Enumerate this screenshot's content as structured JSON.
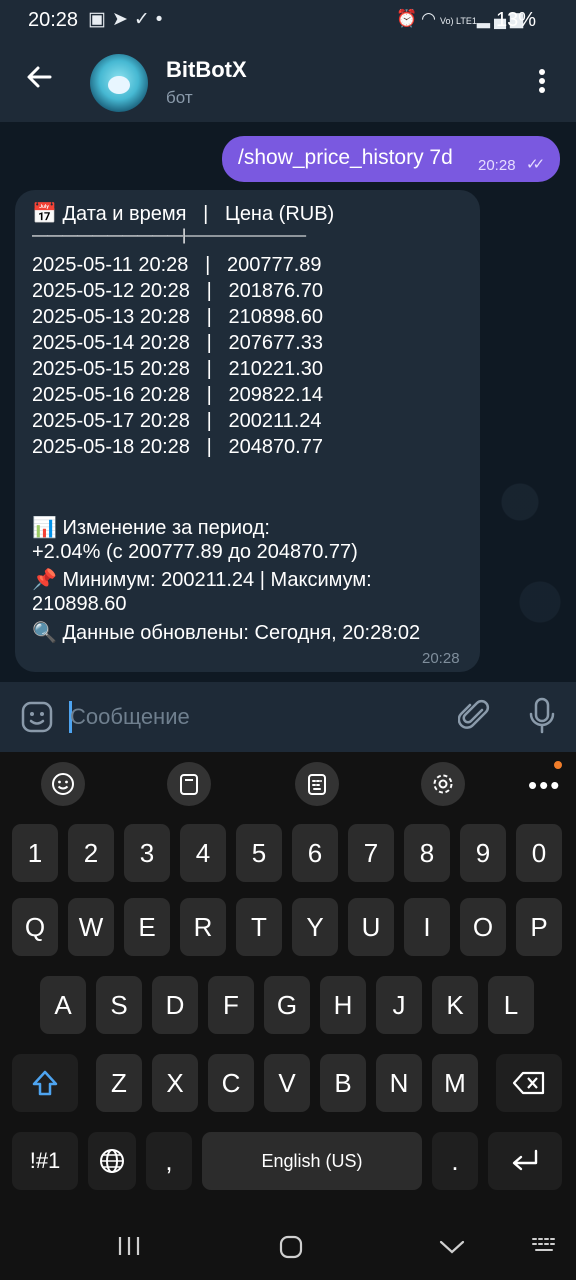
{
  "status_bar": {
    "time": "20:28",
    "left_icons": [
      "gallery-icon",
      "telegram-icon",
      "check-circle-icon",
      "dot-icon"
    ],
    "right_icons": [
      "alarm-icon",
      "wifi-icon",
      "volte-icon",
      "signal-icon"
    ],
    "volte_label": "Vo) LTE1",
    "battery": "13%"
  },
  "header": {
    "title": "BitBotX",
    "subtitle": "бот"
  },
  "messages": {
    "outgoing": {
      "text": "/show_price_history 7d",
      "time": "20:28"
    },
    "incoming": {
      "header_line": "📅 Дата и время   |   Цена (RUB)",
      "separator": "——————————|————————",
      "rows": [
        "2025-05-11 20:28   |   200777.89",
        "2025-05-12 20:28   |   201876.70",
        "2025-05-13 20:28   |   210898.60",
        "2025-05-14 20:28   |   207677.33",
        "2025-05-15 20:28   |   210221.30",
        "2025-05-16 20:28   |   209822.14",
        "2025-05-17 20:28   |   200211.24",
        "2025-05-18 20:28   |   204870.77"
      ],
      "change_title": "📊 Изменение за период:",
      "change_value": "+2.04% (с 200777.89 до 204870.77)",
      "min_max_line1": "📌 Минимум: 200211.24 | Максимум:",
      "min_max_line2": "210898.60",
      "updated": "🔍 Данные обновлены: Сегодня, 20:28:02",
      "time": "20:28"
    }
  },
  "composer": {
    "placeholder": "Сообщение"
  },
  "keyboard": {
    "row_numbers": [
      "1",
      "2",
      "3",
      "4",
      "5",
      "6",
      "7",
      "8",
      "9",
      "0"
    ],
    "row_top": [
      "Q",
      "W",
      "E",
      "R",
      "T",
      "Y",
      "U",
      "I",
      "O",
      "P"
    ],
    "row_mid": [
      "A",
      "S",
      "D",
      "F",
      "G",
      "H",
      "J",
      "K",
      "L"
    ],
    "row_bottom": [
      "Z",
      "X",
      "C",
      "V",
      "B",
      "N",
      "M"
    ],
    "symbols_label": "!#1",
    "comma": ",",
    "space_label": "English (US)",
    "period": "."
  }
}
